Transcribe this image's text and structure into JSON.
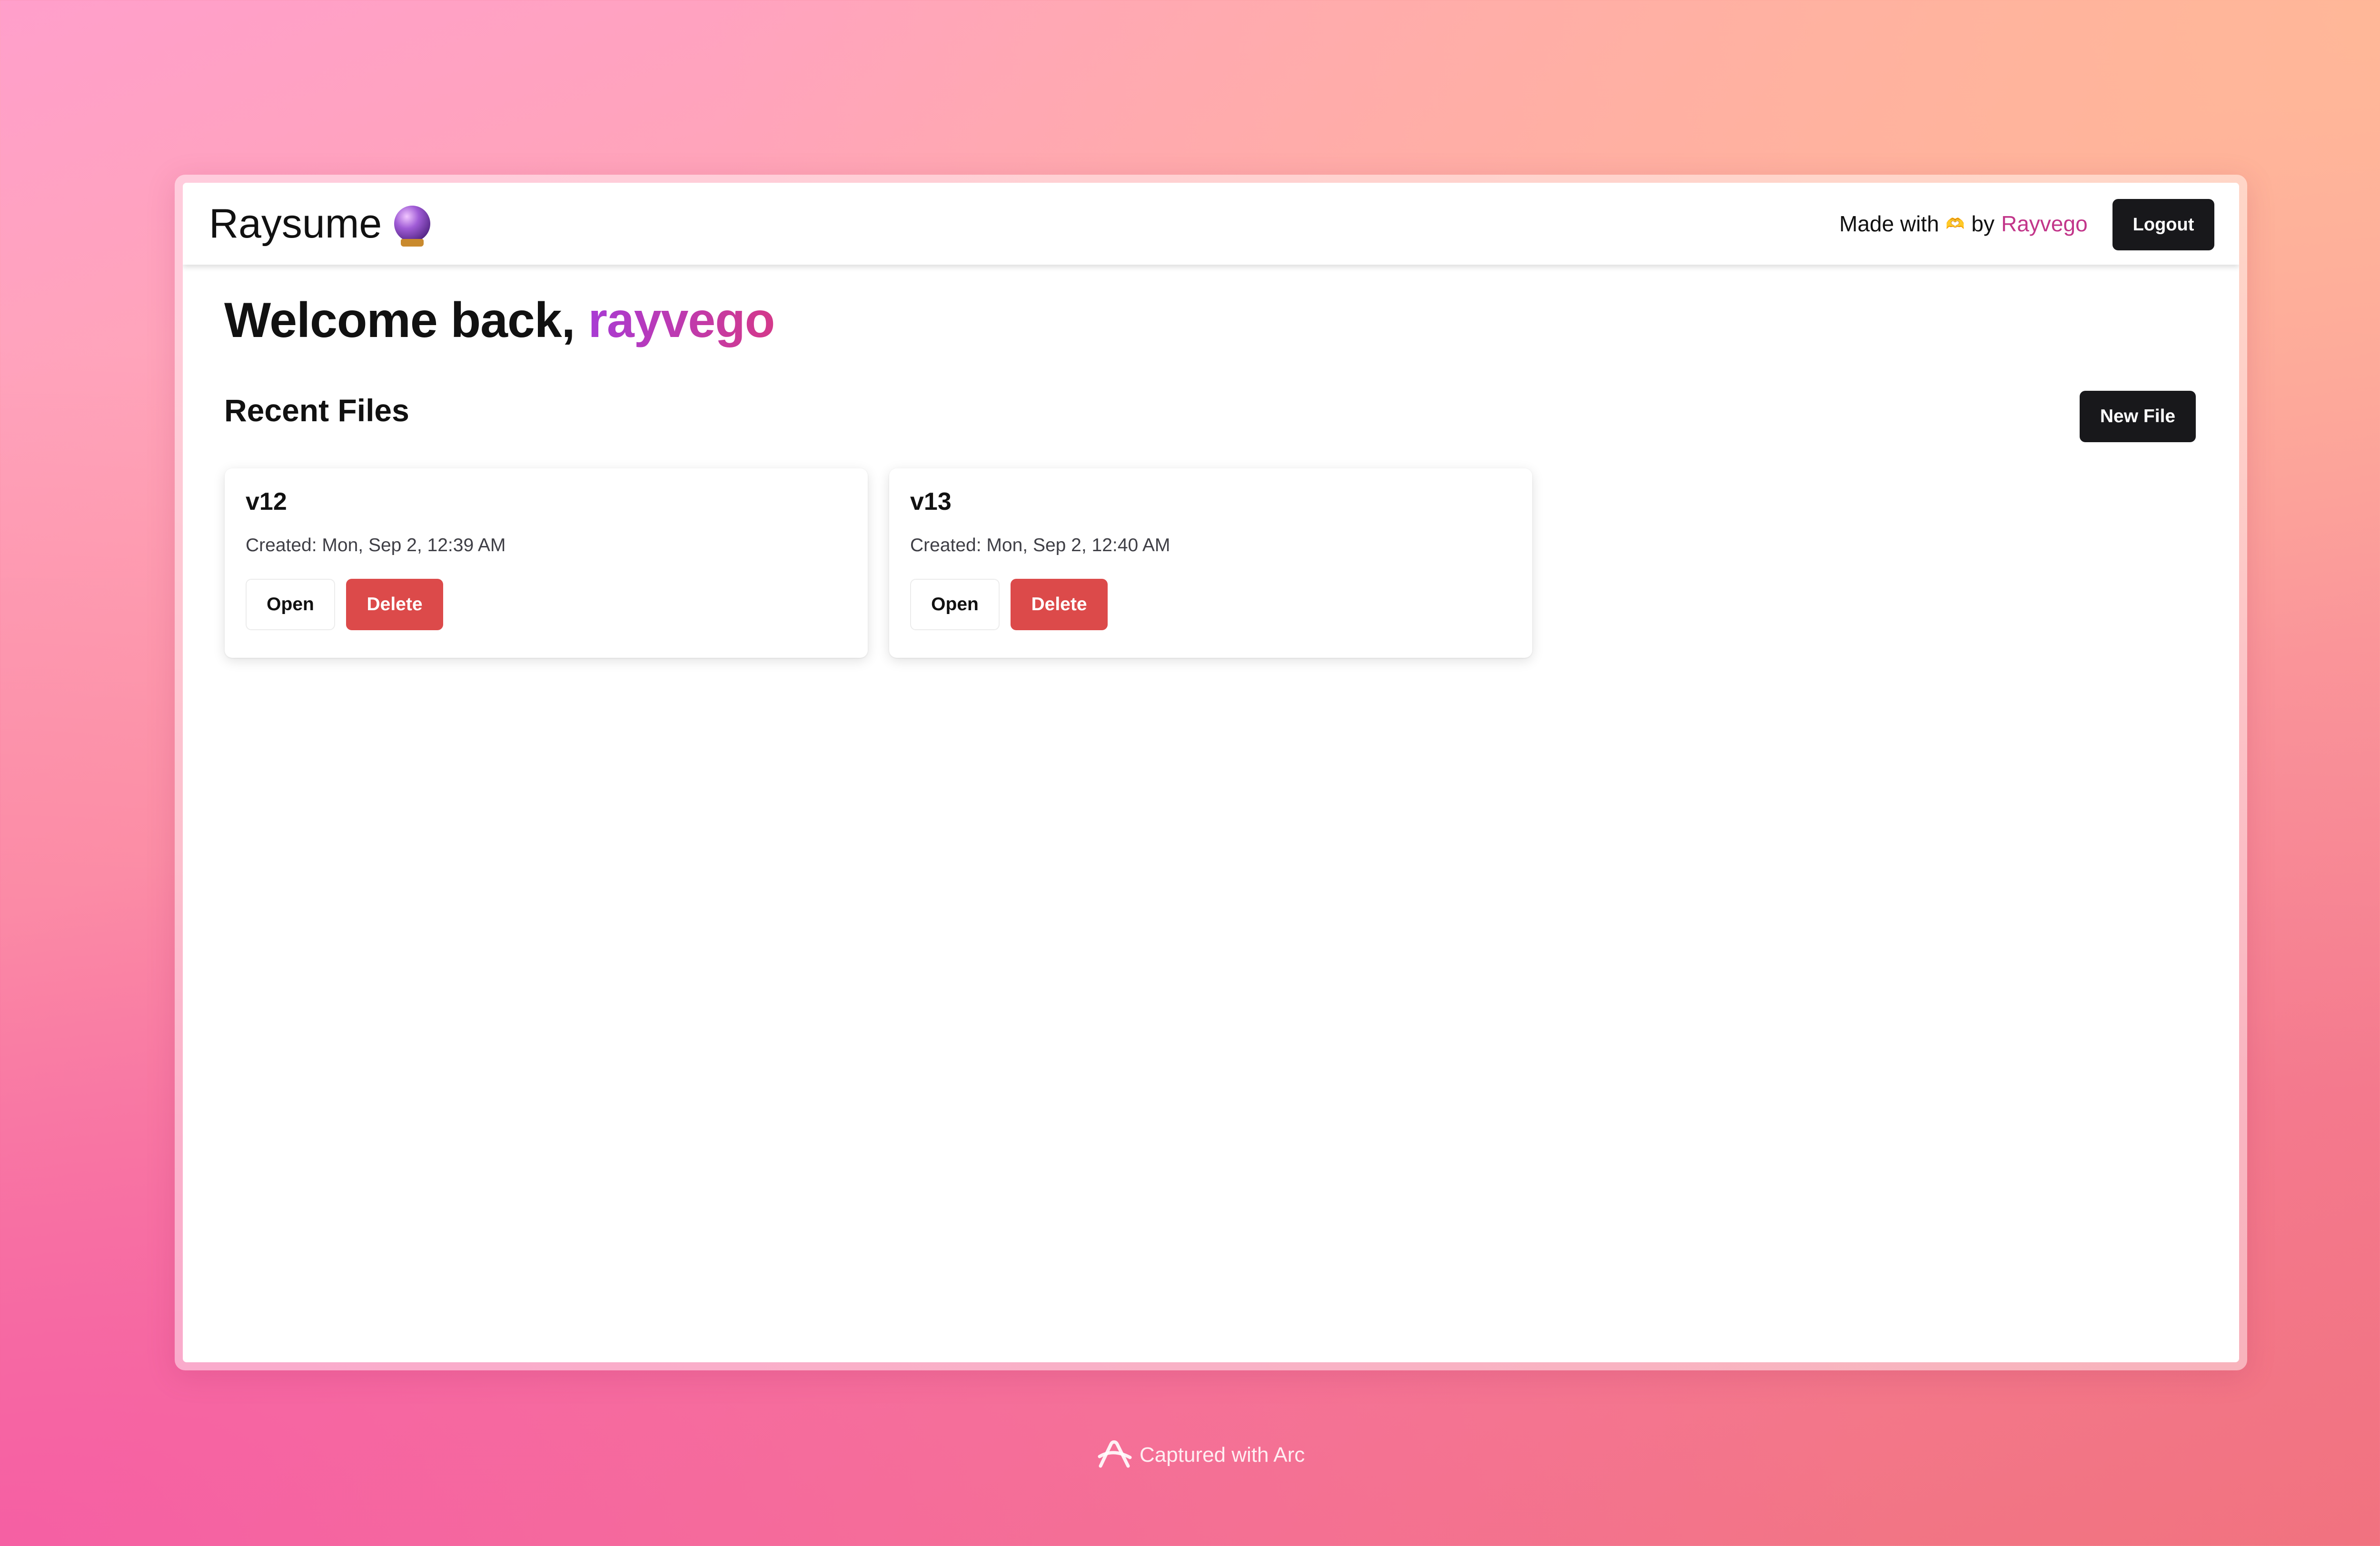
{
  "navbar": {
    "brand_title": "Raysume",
    "brand_emoji_icon": "crystal-ball-icon",
    "made_with_text": "Made with",
    "made_with_icon": "heart-hands-icon",
    "by_text": "by",
    "author_name": "Rayvego",
    "logout_label": "Logout"
  },
  "main": {
    "welcome_prefix": "Welcome back,",
    "username": "rayvego",
    "section_title": "Recent Files",
    "new_file_label": "New File"
  },
  "files": [
    {
      "name": "v12",
      "created": "Created: Mon, Sep 2, 12:39 AM",
      "open_label": "Open",
      "delete_label": "Delete"
    },
    {
      "name": "v13",
      "created": "Created: Mon, Sep 2, 12:40 AM",
      "open_label": "Open",
      "delete_label": "Delete"
    }
  ],
  "footer": {
    "caption": "Captured with Arc",
    "icon": "arc-logo-icon"
  },
  "colors": {
    "accent_pink": "#c2368a",
    "button_dark": "#18181b",
    "delete_red": "#dc4a4a"
  }
}
